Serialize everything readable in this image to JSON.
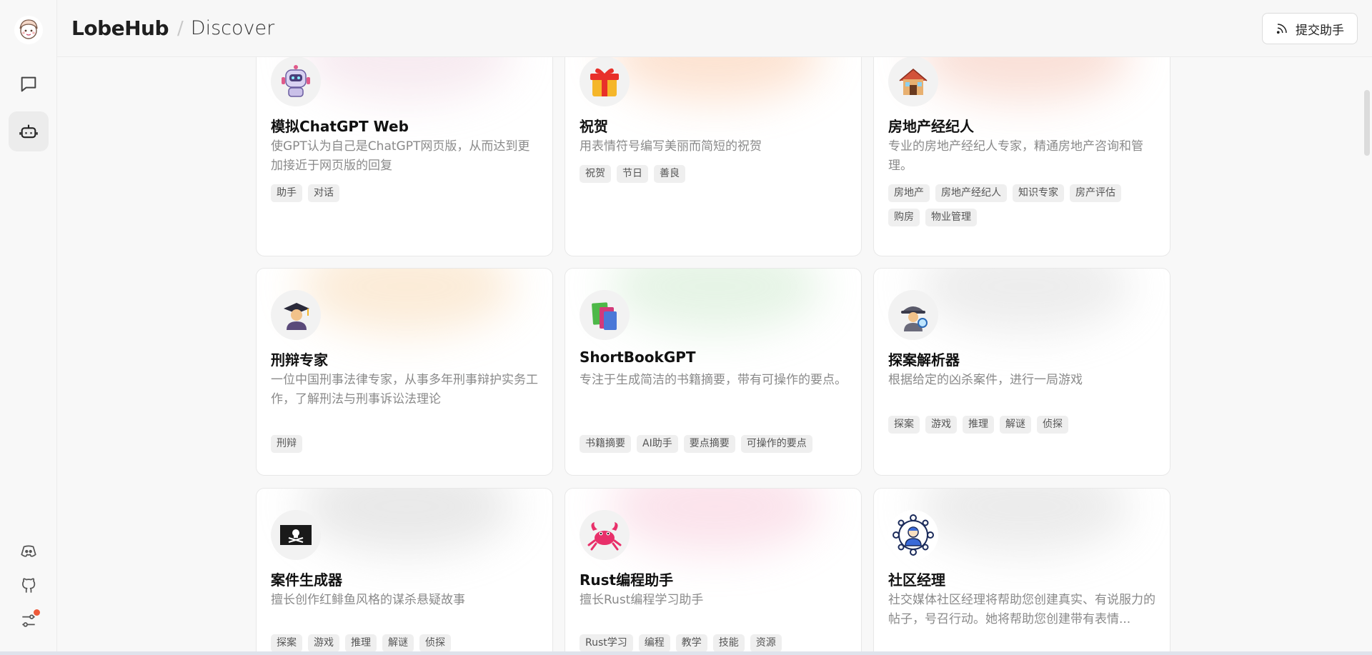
{
  "header": {
    "brand": "LobeHub",
    "separator": "/",
    "breadcrumb": "Discover",
    "submit_label": "提交助手"
  },
  "rail": {
    "icons": [
      "avatar-icon",
      "chat-icon",
      "robot-icon",
      "discord-icon",
      "github-icon",
      "settings-icon"
    ]
  },
  "cards": [
    {
      "title": "模拟ChatGPT Web",
      "desc": "使GPT认为自己是ChatGPT网页版，从而达到更加接近于网页版的回复",
      "tags": [
        "助手",
        "对话"
      ],
      "icon": "robot-emoji",
      "glow": "#e8c6d6"
    },
    {
      "title": "祝贺",
      "desc": "用表情符号编写美丽而简短的祝贺",
      "tags": [
        "祝贺",
        "节日",
        "善良"
      ],
      "icon": "gift-emoji",
      "glow": "#f8b080"
    },
    {
      "title": "房地产经纪人",
      "desc": "专业的房地产经纪人专家，精通房地产咨询和管理。",
      "tags": [
        "房地产",
        "房地产经纪人",
        "知识专家",
        "房产评估",
        "购房",
        "物业管理"
      ],
      "icon": "house-emoji",
      "glow": "#f0a890"
    },
    {
      "title": "刑辩专家",
      "desc": "一位中国刑事法律专家，从事多年刑事辩护实务工作，了解刑法与刑事诉讼法理论",
      "tags": [
        "刑辩"
      ],
      "icon": "graduate-emoji",
      "glow": "#f5c890"
    },
    {
      "title": "ShortBookGPT",
      "desc": "专注于生成简洁的书籍摘要，带有可操作的要点。",
      "tags": [
        "书籍摘要",
        "AI助手",
        "要点摘要",
        "可操作的要点"
      ],
      "icon": "books-emoji",
      "glow": "#b8e0b8"
    },
    {
      "title": "探案解析器",
      "desc": "根据给定的凶杀案件，进行一局游戏",
      "tags": [
        "探案",
        "游戏",
        "推理",
        "解谜",
        "侦探"
      ],
      "icon": "detective-emoji",
      "glow": "#cccccc"
    },
    {
      "title": "案件生成器",
      "desc": "擅长创作红鲱鱼风格的谋杀悬疑故事",
      "tags": [
        "探案",
        "游戏",
        "推理",
        "解谜",
        "侦探"
      ],
      "icon": "pirate-flag-emoji",
      "glow": "#c0c0c0"
    },
    {
      "title": "Rust编程助手",
      "desc": "擅长Rust编程学习助手",
      "tags": [
        "Rust学习",
        "编程",
        "教学",
        "技能",
        "资源"
      ],
      "icon": "crab-emoji",
      "glow": "#f4b0c8"
    },
    {
      "title": "社区经理",
      "desc": "社交媒体社区经理将帮助您创建真实、有说服力的帖子，号召行动。她将帮助您创建带有表情...",
      "tags": [],
      "icon": "community-manager-icon",
      "glow": "#c8c8c8"
    }
  ]
}
